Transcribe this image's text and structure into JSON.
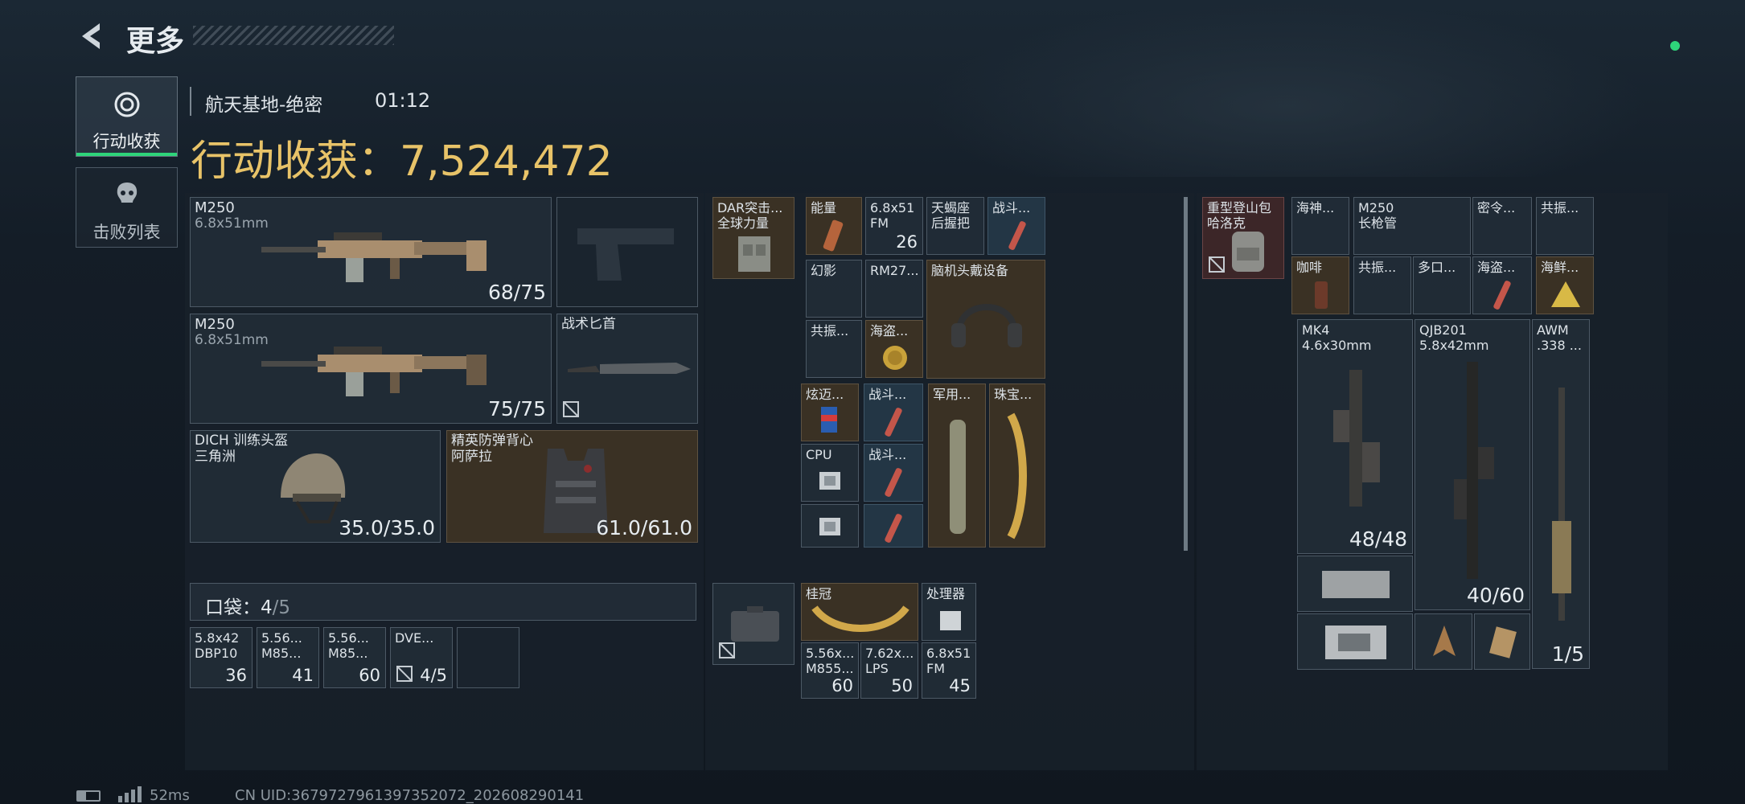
{
  "header": {
    "title": "更多"
  },
  "sidebar": {
    "tabs": [
      {
        "label": "行动收获"
      },
      {
        "label": "击败列表"
      }
    ]
  },
  "raid": {
    "map": "航天基地-绝密",
    "time": "01:12",
    "value_label": "行动收获：",
    "value": "7,524,472"
  },
  "gear": {
    "weapon1": {
      "name": "M250",
      "ammo": "6.8x51mm",
      "count": "68/75"
    },
    "weapon2": {
      "name": "M250",
      "ammo": "6.8x51mm",
      "count": "75/75"
    },
    "melee": {
      "name": "战术匕首"
    },
    "helmet": {
      "name": "DICH 训练头盔",
      "sub": "三角洲",
      "durability": "35.0/35.0"
    },
    "armor": {
      "name": "精英防弹背心",
      "sub": "阿萨拉",
      "durability": "61.0/61.0"
    }
  },
  "pockets": {
    "label": "口袋：",
    "used": "4",
    "total": "/5",
    "items": [
      {
        "name": "5.8x42\nDBP10",
        "count": "36"
      },
      {
        "name": "5.56...\nM85...",
        "count": "41"
      },
      {
        "name": "5.56...\nM85...",
        "count": "60"
      },
      {
        "name": "DVE...",
        "count": "4/5"
      }
    ]
  },
  "chest_rig": {
    "name": "DAR突击...\n全球力量",
    "items": {
      "energy": "能量",
      "ammo68": "6.8x51\nFM",
      "ammo68_count": "26",
      "scorpio": "天蝎座\n后握把",
      "combat1": "战斗...",
      "phantom": "幻影",
      "rm27": "RM27...",
      "headset": "脑机头戴设备",
      "resonance1": "共振...",
      "pirate1": "海盗...",
      "xuanmai": "炫迈...",
      "combat2": "战斗...",
      "military": "军用...",
      "jewelry": "珠宝...",
      "cpu": "CPU",
      "combat3": "战斗..."
    }
  },
  "pouch": {
    "items": {
      "laurel": "桂冠",
      "processor": "处理器",
      "a556": "5.56x...\nM855...",
      "a556_count": "60",
      "a762": "7.62x...\nLPS",
      "a762_count": "50",
      "a68": "6.8x51\nFM",
      "a68_count": "45"
    }
  },
  "backpack": {
    "name": "重型登山包\n哈洛克",
    "items": {
      "neptune": "海神...",
      "coffee": "咖啡",
      "m250barrel": "M250\n长枪管",
      "password": "密令...",
      "resonance2": "共振...",
      "resonance3": "共振...",
      "multiport": "多口...",
      "pirate2": "海盗...",
      "seafood": "海鲜...",
      "mk4": "MK4\n4.6x30mm",
      "mk4_count": "48/48",
      "qjb": "QJB201\n5.8x42mm",
      "qjb_count": "40/60",
      "awm": "AWM\n.338 ...",
      "awm_count": "1/5"
    }
  },
  "status": {
    "ping": "52ms",
    "uid": "CN UID:3679727961397352072_202608290141"
  },
  "colors": {
    "accent": "#e8c368",
    "green": "#2ed47a"
  }
}
